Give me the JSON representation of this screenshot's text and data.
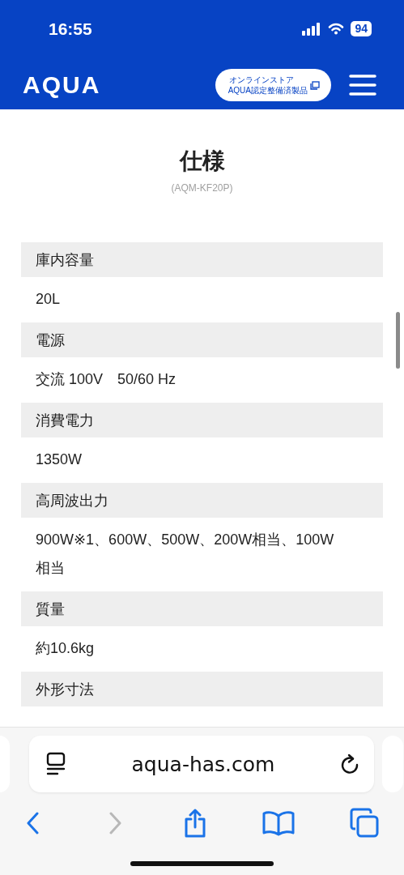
{
  "status_bar": {
    "time": "16:55",
    "battery": "94"
  },
  "header": {
    "logo": "AQUA",
    "store_button": {
      "line_1": "オンラインストア",
      "line_2": "AQUA認定整備済製品"
    }
  },
  "page": {
    "title": "仕様",
    "model": "(AQM-KF20P)"
  },
  "specs": [
    {
      "label": "庫内容量",
      "value": "20L"
    },
    {
      "label": "電源",
      "value": "交流 100V　50/60 Hz"
    },
    {
      "label": "消費電力",
      "value": "1350W"
    },
    {
      "label": "高周波出力",
      "value": "900W※1、600W、500W、200W相当、100W相当"
    },
    {
      "label": "質量",
      "value": "約10.6kg"
    },
    {
      "label": "外形寸法"
    }
  ],
  "browser": {
    "url": "aqua-has.com",
    "nav": [
      {
        "kind": "back",
        "disabled": false
      },
      {
        "kind": "forward",
        "disabled": true
      }
    ]
  }
}
